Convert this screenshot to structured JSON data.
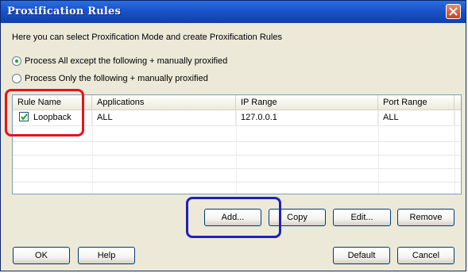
{
  "window": {
    "title": "Proxification Rules"
  },
  "description": "Here you can select Proxification Mode and create Proxification Rules",
  "modes": [
    {
      "label": "Process All except the following + manually proxified",
      "checked": true
    },
    {
      "label": "Process Only the following + manually proxified",
      "checked": false
    }
  ],
  "rules_table": {
    "columns": [
      "Rule Name",
      "Applications",
      "IP Range",
      "Port Range"
    ],
    "rows": [
      {
        "enabled": true,
        "name": "Loopback",
        "applications": "ALL",
        "ip_range": "127.0.0.1",
        "port_range": "ALL"
      }
    ]
  },
  "rule_buttons": {
    "add": "Add...",
    "copy": "Copy",
    "edit": "Edit...",
    "remove": "Remove"
  },
  "dialog_buttons": {
    "ok": "OK",
    "help": "Help",
    "default": "Default",
    "cancel": "Cancel"
  },
  "colors": {
    "titlebar": "#1c52c8",
    "annotation_red": "#e3141a",
    "annotation_blue": "#2120b8",
    "radio_dot": "#21a121"
  }
}
